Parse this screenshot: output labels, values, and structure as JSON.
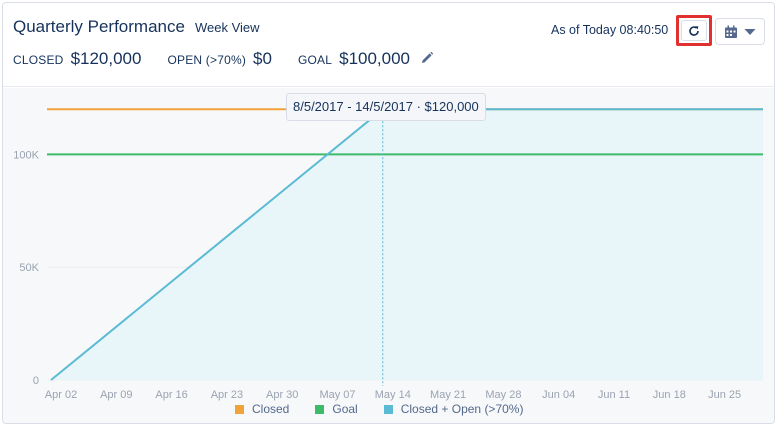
{
  "header": {
    "title": "Quarterly Performance",
    "subtitle": "Week View",
    "as_of": "As of Today 08:40:50"
  },
  "metrics": [
    {
      "label": "CLOSED",
      "value": "$120,000"
    },
    {
      "label": "OPEN (>70%)",
      "value": "$0"
    },
    {
      "label": "GOAL",
      "value": "$100,000"
    }
  ],
  "icons": {
    "edit": "pencil-icon",
    "refresh": "refresh-icon",
    "calendar": "calendar-icon",
    "dropdown": "chevron-down-icon"
  },
  "tooltip": {
    "text": "8/5/2017 - 14/5/2017 · $120,000"
  },
  "colors": {
    "closed": "#f0a33a",
    "goal": "#3dba6a",
    "closed_open": "#5bbad4",
    "area_fill": "#e8f6f9"
  },
  "chart_data": {
    "type": "line",
    "categories": [
      "Apr 02",
      "Apr 09",
      "Apr 16",
      "Apr 23",
      "Apr 30",
      "May 07",
      "May 14",
      "May 21",
      "May 28",
      "Jun 04",
      "Jun 11",
      "Jun 18",
      "Jun 25"
    ],
    "ylim": [
      0,
      125000
    ],
    "yticks": [
      {
        "value": 0,
        "label": "0"
      },
      {
        "value": 50000,
        "label": "50K"
      },
      {
        "value": 100000,
        "label": "100K"
      }
    ],
    "series": [
      {
        "name": "Closed",
        "type": "horizontal",
        "value": 120000
      },
      {
        "name": "Goal",
        "type": "horizontal",
        "value": 100000
      },
      {
        "name": "Closed + Open (>70%)",
        "type": "area",
        "points": [
          {
            "x": "Apr 02",
            "y": 0
          },
          {
            "x": "May 14",
            "y": 120000
          },
          {
            "x": "Jun 25",
            "y": 120000
          }
        ]
      }
    ],
    "highlight": {
      "x": "May 14",
      "y": 120000
    }
  }
}
